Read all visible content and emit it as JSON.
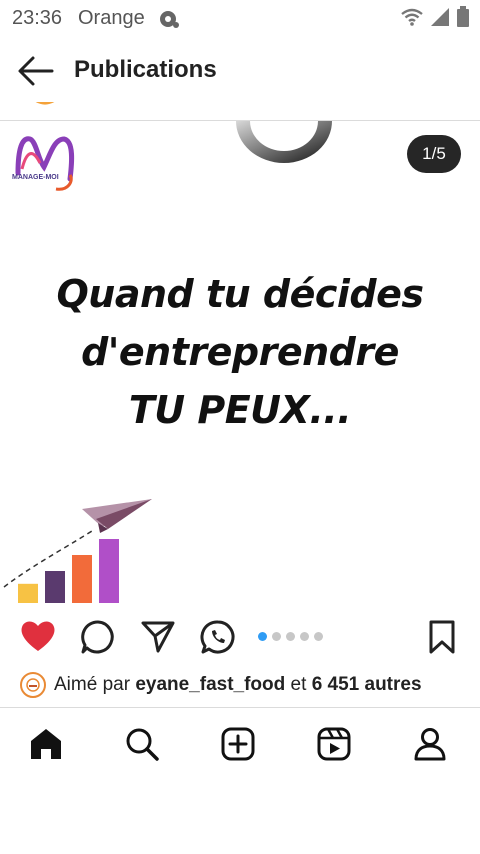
{
  "status": {
    "time": "23:36",
    "carrier": "Orange"
  },
  "header": {
    "title": "Publications"
  },
  "post": {
    "brand_name": "MANAGE-MOI",
    "counter": "1/5",
    "headline": [
      "Quand tu décides",
      "d'entreprendre",
      "TU PEUX..."
    ],
    "chart_bars": [
      {
        "color": "#f7c244",
        "height": 0.3
      },
      {
        "color": "#5a3a6e",
        "height": 0.5
      },
      {
        "color": "#f26b3a",
        "height": 0.75
      },
      {
        "color": "#b04fc8",
        "height": 1.0
      }
    ]
  },
  "actions": {
    "liked": true,
    "carousel_total": 5,
    "carousel_index": 1
  },
  "likes": {
    "prefix": "Aimé par",
    "user": "eyane_fast_food",
    "connector": "et",
    "count": "6 451 autres"
  },
  "nav": {
    "items": [
      "home",
      "search",
      "create",
      "reels",
      "profile"
    ]
  },
  "colors": {
    "like": "#e0303e",
    "accent": "#2f9cf4"
  }
}
